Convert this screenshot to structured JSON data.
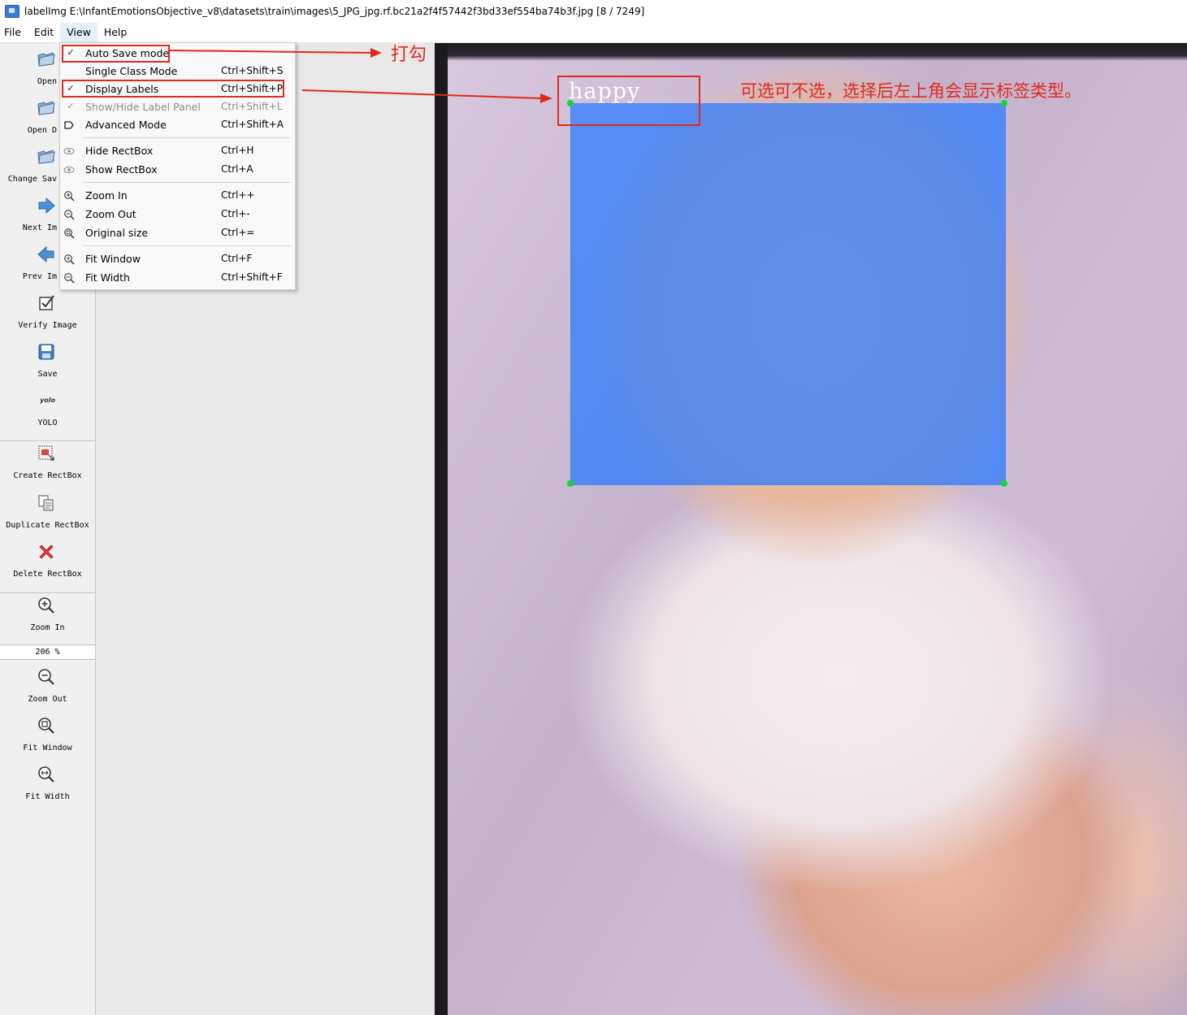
{
  "window": {
    "title": "labelImg E:\\InfantEmotionsObjective_v8\\datasets\\train\\images\\5_JPG_jpg.rf.bc21a2f4f57442f3bd33ef554ba74b3f.jpg [8 / 7249]"
  },
  "menubar": [
    "File",
    "Edit",
    "View",
    "Help"
  ],
  "toolbar": {
    "items": [
      {
        "label": "Open",
        "icon": "folder-open-icon"
      },
      {
        "label": "Open D",
        "icon": "folder-open-icon"
      },
      {
        "label": "Change Sav",
        "icon": "folder-open-icon"
      },
      {
        "label": "Next Im",
        "icon": "arrow-right-icon"
      },
      {
        "label": "Prev Im",
        "icon": "arrow-left-icon"
      },
      {
        "label": "Verify Image",
        "icon": "checkbox-icon"
      },
      {
        "label": "Save",
        "icon": "floppy-disk-icon"
      },
      {
        "label": "YOLO",
        "icon_text": "yolo"
      },
      {
        "label": "Create RectBox",
        "icon": "create-rectbox-icon"
      },
      {
        "label": "Duplicate RectBox",
        "icon": "duplicate-icon"
      },
      {
        "label": "Delete RectBox",
        "icon": "delete-x-icon"
      },
      {
        "label": "Zoom In",
        "icon": "zoom-in-icon"
      },
      {
        "label": "Zoom Out",
        "icon": "zoom-out-icon"
      },
      {
        "label": "Fit Window",
        "icon": "fit-window-icon"
      },
      {
        "label": "Fit Width",
        "icon": "fit-width-icon"
      }
    ],
    "zoom_value": "206 %"
  },
  "view_menu": {
    "items": [
      {
        "label": "Auto Save mode",
        "shortcut": "",
        "checked": true
      },
      {
        "label": "Single Class Mode",
        "shortcut": "Ctrl+Shift+S"
      },
      {
        "label": "Display Labels",
        "shortcut": "Ctrl+Shift+P",
        "checked": true
      },
      {
        "label": "Show/Hide Label Panel",
        "shortcut": "Ctrl+Shift+L",
        "disabled": true
      },
      {
        "label": "Advanced Mode",
        "shortcut": "Ctrl+Shift+A"
      },
      {
        "label": "Hide RectBox",
        "shortcut": "Ctrl+H"
      },
      {
        "label": "Show RectBox",
        "shortcut": "Ctrl+A"
      },
      {
        "label": "Zoom In",
        "shortcut": "Ctrl++"
      },
      {
        "label": "Zoom Out",
        "shortcut": "Ctrl+-"
      },
      {
        "label": "Original size",
        "shortcut": "Ctrl+="
      },
      {
        "label": "Fit Window",
        "shortcut": "Ctrl+F"
      },
      {
        "label": "Fit Width",
        "shortcut": "Ctrl+Shift+F"
      }
    ]
  },
  "canvas": {
    "box_label": "happy",
    "box_color": "#2878ff"
  },
  "annotations": {
    "tick_note": "打勾",
    "label_note": "可选可不选，选择后左上角会显示标签类型。",
    "color": "#e02a1c"
  }
}
